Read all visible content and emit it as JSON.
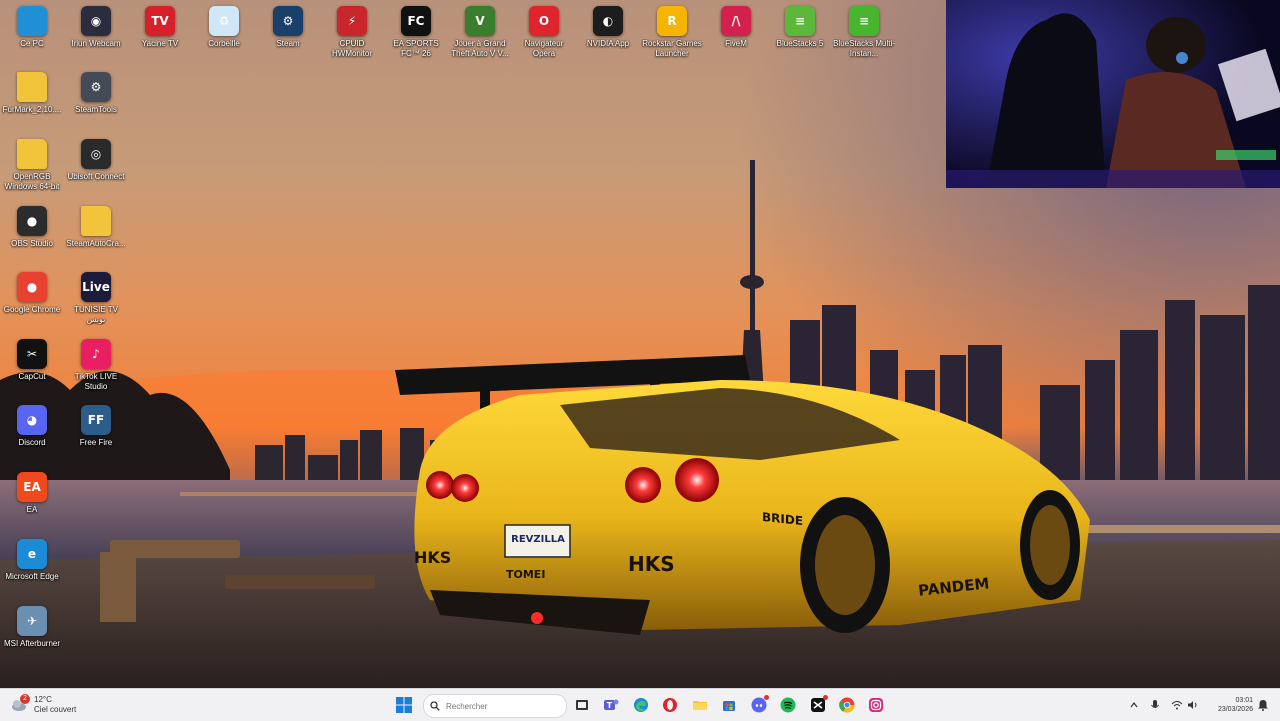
{
  "desktop": {
    "icons": [
      {
        "label": "Ce PC",
        "icon": "this-pc-icon",
        "glyph": "",
        "color": "#1f8fd6"
      },
      {
        "label": "Iriun Webcam",
        "icon": "iriun-webcam-icon",
        "glyph": "◉",
        "color": "#2b2d3c"
      },
      {
        "label": "Yacine TV",
        "icon": "yacine-tv-icon",
        "glyph": "TV",
        "color": "#d8202a"
      },
      {
        "label": "Corbeille",
        "icon": "recycle-bin-icon",
        "glyph": "♻",
        "color": "#cfe7f7"
      },
      {
        "label": "Steam",
        "icon": "steam-icon",
        "glyph": "⚙",
        "color": "#1b3f6b"
      },
      {
        "label": "CPUID HWMonitor",
        "icon": "hwmonitor-icon",
        "glyph": "⚡",
        "color": "#c9262c"
      },
      {
        "label": "EA SPORTS FC™ 26",
        "icon": "ea-fc-icon",
        "glyph": "FC",
        "color": "#111111"
      },
      {
        "label": "Jouer à Grand Theft Auto V V...",
        "icon": "gta-v-icon",
        "glyph": "V",
        "color": "#3a7d2c"
      },
      {
        "label": "Navigateur Opera",
        "icon": "opera-icon",
        "glyph": "O",
        "color": "#e0242c"
      },
      {
        "label": "NVIDIA App",
        "icon": "nvidia-icon",
        "glyph": "◐",
        "color": "#1d1d1d"
      },
      {
        "label": "Rockstar Games Launcher",
        "icon": "rockstar-icon",
        "glyph": "R",
        "color": "#f5b400"
      },
      {
        "label": "FiveM",
        "icon": "fivem-icon",
        "glyph": "/\\",
        "color": "#d4204d"
      },
      {
        "label": "BlueStacks 5",
        "icon": "bluestacks-icon",
        "glyph": "≡",
        "color": "#5cb73a"
      },
      {
        "label": "BlueStacks Multi-Instan...",
        "icon": "bluestacks-multi-icon",
        "glyph": "≡",
        "color": "#47b52e"
      },
      {
        "label": "FurMark_2.10....",
        "icon": "folder-icon",
        "glyph": "",
        "color": "#f2c43b"
      },
      {
        "label": "SteamTools",
        "icon": "steamtools-icon",
        "glyph": "⚙",
        "color": "#444a56"
      },
      {
        "label": "OpenRGB Windows 64-bit",
        "icon": "folder-icon",
        "glyph": "",
        "color": "#f2c43b"
      },
      {
        "label": "Ubisoft Connect",
        "icon": "ubisoft-icon",
        "glyph": "◎",
        "color": "#2a2a2a"
      },
      {
        "label": "OBS Studio",
        "icon": "obs-icon",
        "glyph": "●",
        "color": "#2c2c2c"
      },
      {
        "label": "SteamAutoCra...",
        "icon": "folder-icon",
        "glyph": "",
        "color": "#f2c43b"
      },
      {
        "label": "Google Chrome",
        "icon": "chrome-icon",
        "glyph": "●",
        "color": "#e9412f"
      },
      {
        "label": "TUNISIE TV تونس",
        "icon": "tunisie-tv-icon",
        "glyph": "Live",
        "color": "#1c1c3a"
      },
      {
        "label": "CapCut",
        "icon": "capcut-icon",
        "glyph": "✂",
        "color": "#111111"
      },
      {
        "label": "TikTok LIVE Studio",
        "icon": "tiktok-live-icon",
        "glyph": "♪",
        "color": "#e91e63"
      },
      {
        "label": "Discord",
        "icon": "discord-icon",
        "glyph": "◕",
        "color": "#5865f2"
      },
      {
        "label": "Free Fire",
        "icon": "free-fire-icon",
        "glyph": "FF",
        "color": "#2b5c8a"
      },
      {
        "label": "EA",
        "icon": "ea-icon",
        "glyph": "EA",
        "color": "#f04a1c"
      },
      {
        "label": "Microsoft Edge",
        "icon": "edge-icon",
        "glyph": "e",
        "color": "#1c8bd6"
      },
      {
        "label": "MSI Afterburner",
        "icon": "msi-afterburner-icon",
        "glyph": "✈",
        "color": "#6a8fb1"
      }
    ]
  },
  "wallpaper": {
    "license_plate": "REVZILLA",
    "decal_1": "HKS",
    "decal_2": "TOMEI",
    "decal_3": "BRIDE",
    "decal_4": "PANDEM"
  },
  "taskbar": {
    "weather": {
      "temp": "12°C",
      "condition": "Ciel couvert",
      "badge": "2"
    },
    "search_placeholder": "Rechercher",
    "apps": [
      "start-icon",
      "task-view-icon",
      "teams-icon",
      "edge-icon",
      "opera-icon",
      "file-explorer-icon",
      "store-icon",
      "discord-icon",
      "spotify-icon",
      "capcut-icon",
      "chrome-icon",
      "instagram-icon"
    ],
    "clock": {
      "time": "03:01",
      "date": "23/03/2026"
    }
  }
}
